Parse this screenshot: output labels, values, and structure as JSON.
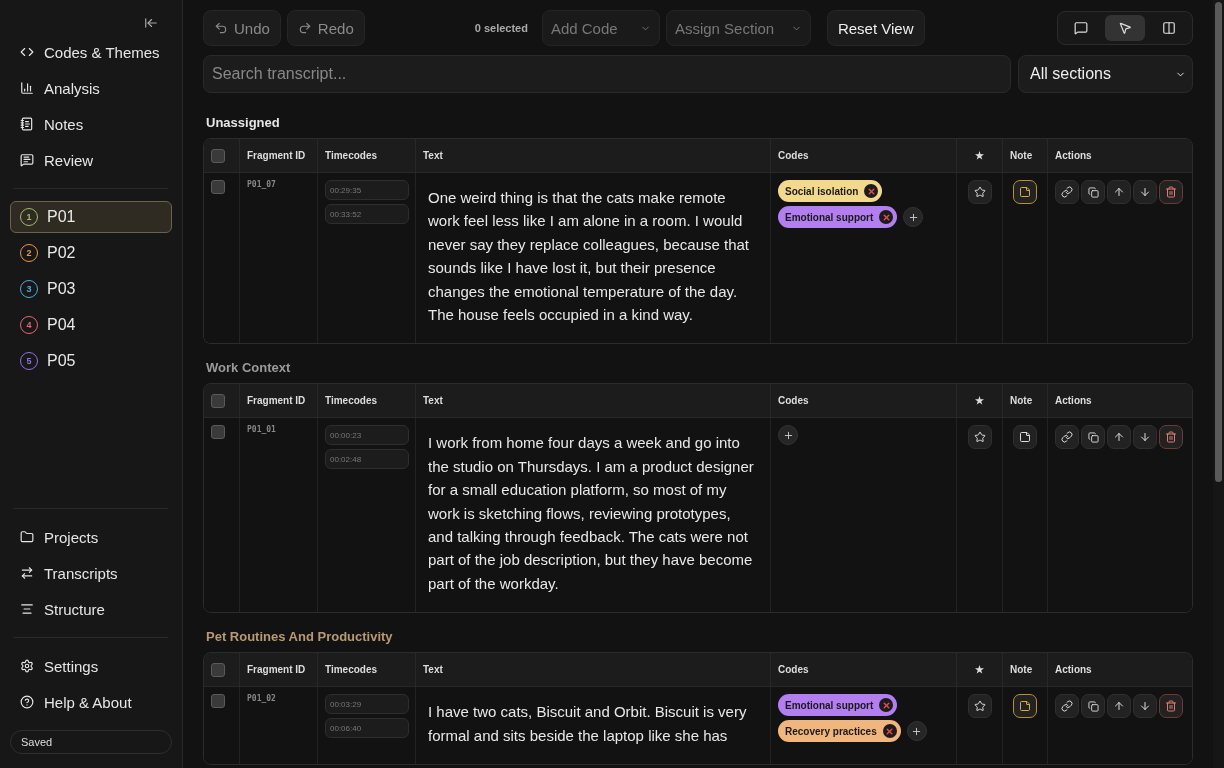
{
  "sidebar": {
    "nav": [
      {
        "label": "Codes & Themes"
      },
      {
        "label": "Analysis"
      },
      {
        "label": "Notes"
      },
      {
        "label": "Review"
      }
    ],
    "participants": [
      {
        "number": "1",
        "label": "P01",
        "color": "#a3b86c",
        "selected": true
      },
      {
        "number": "2",
        "label": "P02",
        "color": "#e39a45",
        "selected": false
      },
      {
        "number": "3",
        "label": "P03",
        "color": "#4eaad8",
        "selected": false
      },
      {
        "number": "4",
        "label": "P04",
        "color": "#e0667c",
        "selected": false
      },
      {
        "number": "5",
        "label": "P05",
        "color": "#8c72e0",
        "selected": false
      }
    ],
    "footer_nav": [
      {
        "label": "Projects"
      },
      {
        "label": "Transcripts"
      },
      {
        "label": "Structure"
      }
    ],
    "bottom_nav": [
      {
        "label": "Settings"
      },
      {
        "label": "Help & About"
      }
    ],
    "status": "Saved"
  },
  "toolbar": {
    "undo": "Undo",
    "redo": "Redo",
    "selected_count": "0 selected",
    "add_code": "Add Code",
    "assign_section": "Assign Section",
    "reset": "Reset View",
    "views": [
      {
        "selected": false
      },
      {
        "selected": true
      },
      {
        "selected": false
      }
    ]
  },
  "search": {
    "placeholder": "Search transcript..."
  },
  "section_filter": "All sections",
  "sections": [
    {
      "title": "Unassigned",
      "color": "#e6e6e6",
      "all_checked": false,
      "columns": [
        "Fragment ID",
        "Timecodes",
        "Text",
        "Codes",
        "★",
        "Note",
        "Actions"
      ],
      "rows": [
        {
          "id": "P01_07",
          "start": "00:29:35",
          "end": "00:33:52",
          "text": "One weird thing is that the cats make remote work feel less like I am alone in a room. I would never say they replace colleagues, because that sounds like I have lost it, but their presence changes the emotional temperature of the day. The house feels occupied in a kind way.",
          "checked": false,
          "starred": false,
          "has_note": true,
          "codes": [
            {
              "label": "Social isolation",
              "color": "#f2d98c"
            },
            {
              "label": "Emotional support",
              "color": "#b27ef0"
            }
          ]
        }
      ]
    },
    {
      "title": "Work Context",
      "color": "#9a9a9a",
      "all_checked": false,
      "columns": [
        "Fragment ID",
        "Timecodes",
        "Text",
        "Codes",
        "★",
        "Note",
        "Actions"
      ],
      "rows": [
        {
          "id": "P01_01",
          "start": "00:00:23",
          "end": "00:02:48",
          "text": "I work from home four days a week and go into the studio on Thursdays. I am a product designer for a small education platform, so most of my work is sketching flows, reviewing prototypes, and talking through feedback. The cats were not part of the job description, but they have become part of the workday.",
          "checked": false,
          "starred": false,
          "has_note": false,
          "codes": []
        }
      ]
    },
    {
      "title": "Pet Routines And Productivity",
      "color": "#b89a72",
      "all_checked": false,
      "columns": [
        "Fragment ID",
        "Timecodes",
        "Text",
        "Codes",
        "★",
        "Note",
        "Actions"
      ],
      "rows": [
        {
          "id": "P01_02",
          "start": "00:03:29",
          "end": "00:06:40",
          "text": "I have two cats, Biscuit and Orbit. Biscuit is very formal and sits beside the laptop like she has",
          "checked": false,
          "starred": false,
          "has_note": true,
          "codes": [
            {
              "label": "Emotional support",
              "color": "#b27ef0"
            },
            {
              "label": "Recovery practices",
              "color": "#f0b67e"
            }
          ]
        }
      ]
    }
  ]
}
